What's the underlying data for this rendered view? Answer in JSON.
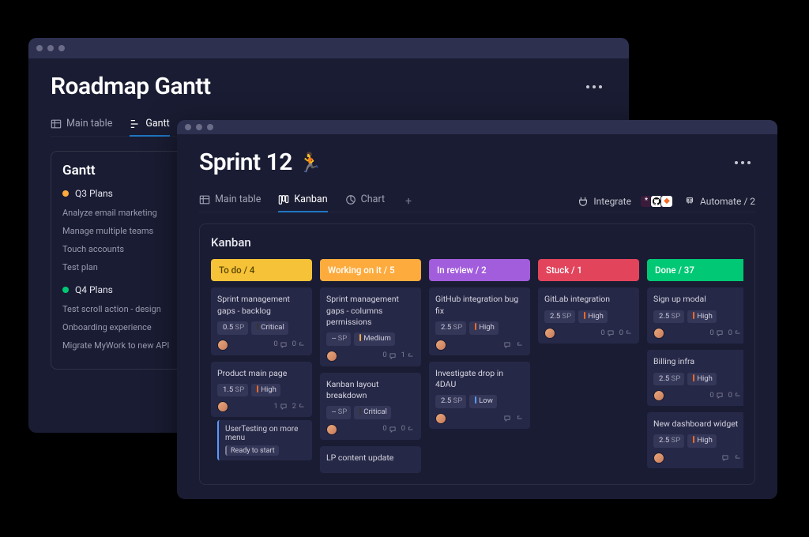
{
  "back_window": {
    "title": "Roadmap Gantt",
    "tabs": [
      {
        "label": "Main table"
      },
      {
        "label": "Gantt"
      }
    ],
    "side": {
      "title": "Gantt",
      "groups": [
        {
          "name": "Q3 Plans",
          "color": "yellow",
          "items": [
            "Analyze email marketing",
            "Manage multiple teams",
            "Touch accounts",
            "Test plan"
          ]
        },
        {
          "name": "Q4 Plans",
          "color": "green",
          "items": [
            "Test scroll action - design",
            "Onboarding experience",
            "Migrate MyWork to new API"
          ]
        }
      ]
    }
  },
  "front_window": {
    "title": "Sprint 12",
    "emoji": "🏃",
    "tabs": [
      {
        "label": "Main table"
      },
      {
        "label": "Kanban"
      },
      {
        "label": "Chart"
      }
    ],
    "integrate_label": "Integrate",
    "automate_label": "Automate / 2",
    "board_title": "Kanban",
    "columns": [
      {
        "header": "To do / 4",
        "color": "hc-todo",
        "cards": [
          {
            "title": "Sprint management gaps - backlog",
            "sp": "0.5",
            "sp_label": "SP",
            "prio": "Critical",
            "prio_bar": "crit",
            "comments": "0",
            "sub": "0"
          },
          {
            "title": "Product main page",
            "sp": "1.5",
            "sp_label": "SP",
            "prio": "High",
            "prio_bar": "high",
            "comments": "1",
            "sub": "2",
            "subtask": {
              "title": "UserTesting on more menu",
              "status": "Ready to start"
            }
          }
        ]
      },
      {
        "header": "Working on it / 5",
        "color": "hc-work",
        "cards": [
          {
            "title": "Sprint management gaps - columns permissions",
            "sp": "--",
            "sp_label": "SP",
            "prio": "Medium",
            "prio_bar": "med",
            "comments": "0",
            "sub": "1"
          },
          {
            "title": "Kanban layout breakdown",
            "sp": "--",
            "sp_label": "SP",
            "prio": "Critical",
            "prio_bar": "crit",
            "comments": "0",
            "sub": "0"
          },
          {
            "title": "LP content update"
          }
        ]
      },
      {
        "header": "In review / 2",
        "color": "hc-rev",
        "cards": [
          {
            "title": "GitHub integration bug fix",
            "sp": "2.5",
            "sp_label": "SP",
            "prio": "High",
            "prio_bar": "high",
            "comments": "",
            "sub": ""
          },
          {
            "title": "Investigate drop in 4DAU",
            "sp": "2.5",
            "sp_label": "SP",
            "prio": "Low",
            "prio_bar": "low",
            "comments": "",
            "sub": ""
          }
        ]
      },
      {
        "header": "Stuck / 1",
        "color": "hc-stuck",
        "cards": [
          {
            "title": "GitLab integration",
            "sp": "2.5",
            "sp_label": "SP",
            "prio": "High",
            "prio_bar": "high",
            "comments": "0",
            "sub": "0"
          }
        ]
      },
      {
        "header": "Done  / 37",
        "color": "hc-done",
        "cards": [
          {
            "title": "Sign up modal",
            "sp": "2.5",
            "sp_label": "SP",
            "prio": "High",
            "prio_bar": "high",
            "comments": "0",
            "sub": "0"
          },
          {
            "title": "Billing infra",
            "sp": "2.5",
            "sp_label": "SP",
            "prio": "High",
            "prio_bar": "high",
            "comments": "0",
            "sub": "0"
          },
          {
            "title": "New dashboard widget",
            "sp": "2.5",
            "sp_label": "SP",
            "prio": "High",
            "prio_bar": "high"
          }
        ]
      }
    ]
  }
}
